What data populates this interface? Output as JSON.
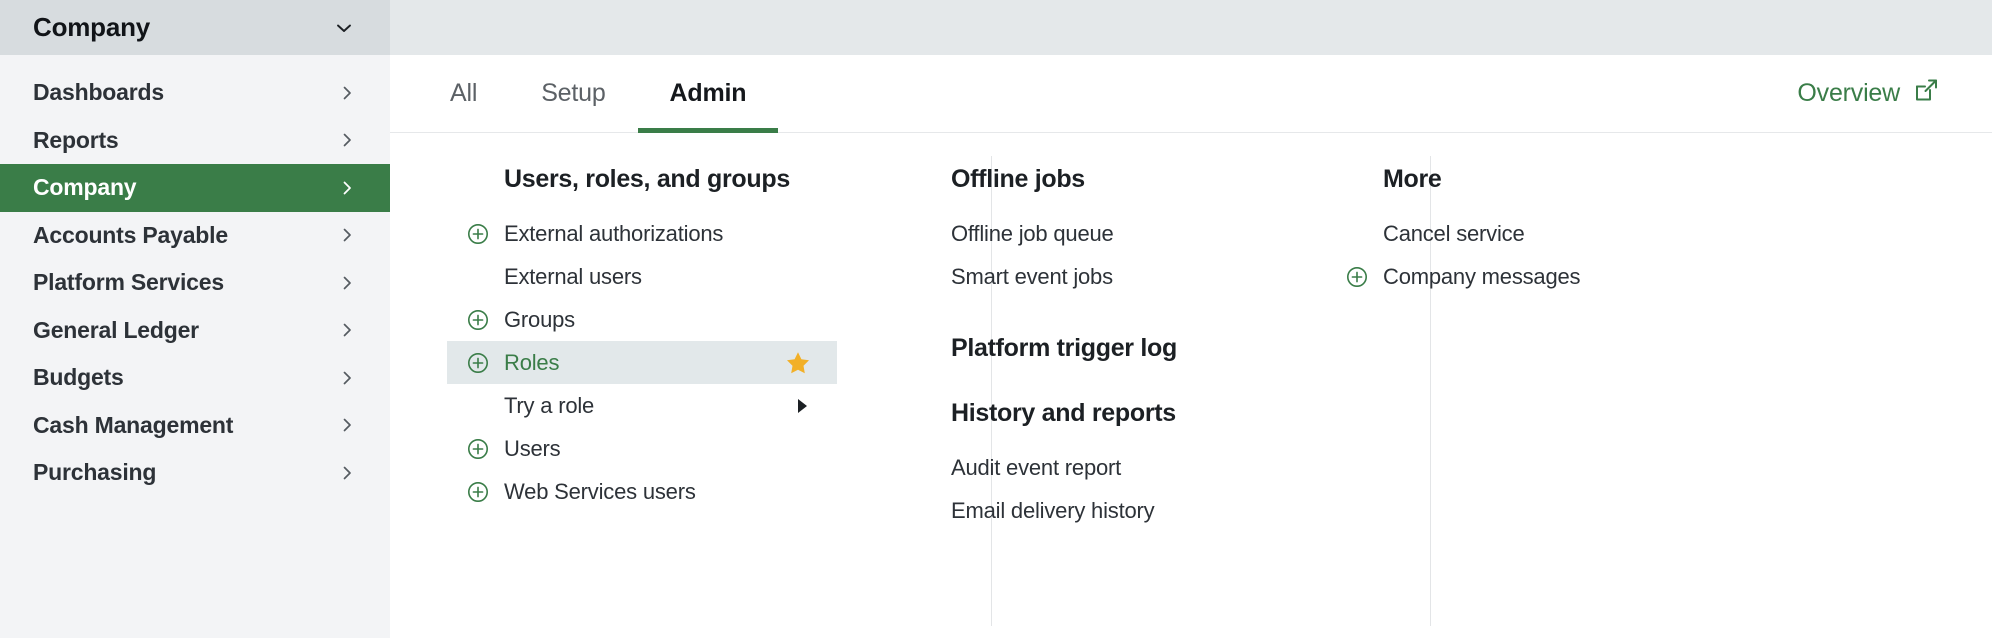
{
  "topbar": {
    "title": "Company",
    "chevron_icon": "chevron-down-icon"
  },
  "sidebar": {
    "items": [
      {
        "label": "Dashboards",
        "active": false,
        "chevron_icon": "chevron-right-icon"
      },
      {
        "label": "Reports",
        "active": false,
        "chevron_icon": "chevron-right-icon"
      },
      {
        "label": "Company",
        "active": true,
        "chevron_icon": "chevron-right-icon"
      },
      {
        "label": "Accounts Payable",
        "active": false,
        "chevron_icon": "chevron-right-icon"
      },
      {
        "label": "Platform Services",
        "active": false,
        "chevron_icon": "chevron-right-icon"
      },
      {
        "label": "General Ledger",
        "active": false,
        "chevron_icon": "chevron-right-icon"
      },
      {
        "label": "Budgets",
        "active": false,
        "chevron_icon": "chevron-right-icon"
      },
      {
        "label": "Cash Management",
        "active": false,
        "chevron_icon": "chevron-right-icon"
      },
      {
        "label": "Purchasing",
        "active": false,
        "chevron_icon": "chevron-right-icon"
      }
    ]
  },
  "tabs": [
    {
      "label": "All",
      "active": false
    },
    {
      "label": "Setup",
      "active": false
    },
    {
      "label": "Admin",
      "active": true
    }
  ],
  "overview": {
    "label": "Overview",
    "icon": "external-link-icon"
  },
  "columns": {
    "col1": {
      "heading": "Users, roles, and groups",
      "items": [
        {
          "label": "External authorizations",
          "plus": true,
          "star": false,
          "submenu": false,
          "highlight": false
        },
        {
          "label": "External users",
          "plus": false,
          "star": false,
          "submenu": false,
          "highlight": false
        },
        {
          "label": "Groups",
          "plus": true,
          "star": false,
          "submenu": false,
          "highlight": false
        },
        {
          "label": "Roles",
          "plus": true,
          "star": true,
          "submenu": false,
          "highlight": true
        },
        {
          "label": "Try a role",
          "plus": false,
          "star": false,
          "submenu": true,
          "highlight": false
        },
        {
          "label": "Users",
          "plus": true,
          "star": false,
          "submenu": false,
          "highlight": false
        },
        {
          "label": "Web Services users",
          "plus": true,
          "star": false,
          "submenu": false,
          "highlight": false
        }
      ]
    },
    "col2": {
      "heading_offline": "Offline jobs",
      "offline_items": [
        {
          "label": "Offline job queue",
          "plus": false
        },
        {
          "label": "Smart event jobs",
          "plus": false
        }
      ],
      "heading_trigger": "Platform trigger log",
      "heading_history": "History and reports",
      "history_items": [
        {
          "label": "Audit event report",
          "plus": false
        },
        {
          "label": "Email delivery history",
          "plus": false
        }
      ]
    },
    "col3": {
      "heading": "More",
      "items": [
        {
          "label": "Cancel service",
          "plus": false
        },
        {
          "label": "Company messages",
          "plus": true
        }
      ]
    }
  },
  "colors": {
    "brand_green": "#3a7d48",
    "star_gold": "#f2b028",
    "header_bg": "#e4e8ea",
    "sidebar_bg": "#f3f4f6",
    "highlight_bg": "#e2e8ea"
  }
}
